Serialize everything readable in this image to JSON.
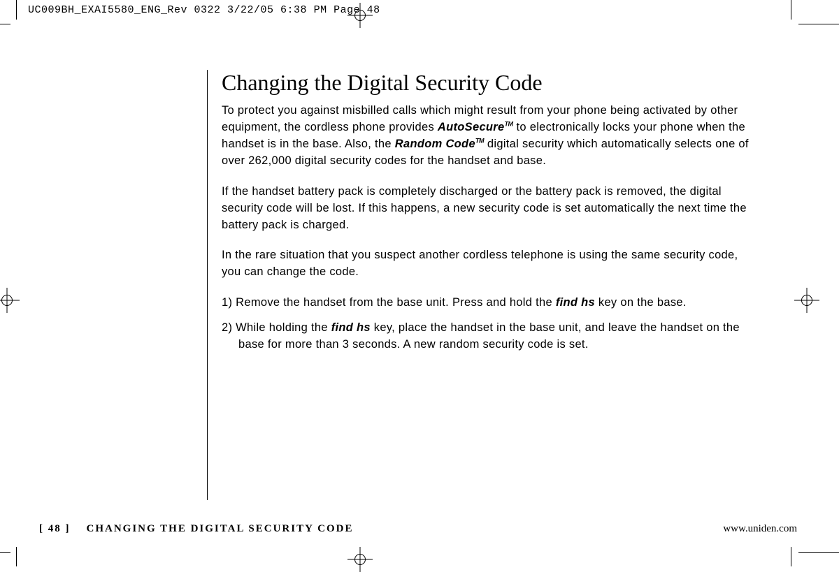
{
  "print_header": "UC009BH_EXAI5580_ENG_Rev 0322  3/22/05  6:38 PM  Page 48",
  "heading": "Changing the Digital Security Code",
  "para1_a": "To protect you against misbilled calls which might result from your phone being activated by other equipment, the cordless phone provides ",
  "para1_brand1": "AutoSecure",
  "para1_b": " to electronically locks your phone when the handset is in the base. Also, the ",
  "para1_brand2": "Random Code",
  "para1_c": " digital security which automatically selects one of over 262,000 digital security codes for the handset and base.",
  "para2": "If the handset battery pack is completely discharged or the battery pack is removed, the digital security code will be lost. If this happens, a new security code is set automatically the next time the battery pack is charged.",
  "para3": "In the rare situation that you suspect another cordless telephone is using the same security code, you can change the code.",
  "step1_a": "1) Remove the handset from the base unit. Press and hold the ",
  "step1_key": "find hs",
  "step1_b": " key on the base.",
  "step2_a": "2) While holding the ",
  "step2_key": "find hs",
  "step2_b": " key, place the handset in the base unit, and leave the handset on the base for more than 3 seconds. A new random security code is set.",
  "footer_page": "[ 48 ]",
  "footer_title": "CHANGING THE DIGITAL SECURITY CODE",
  "footer_url": "www.uniden.com",
  "tm": "TM"
}
